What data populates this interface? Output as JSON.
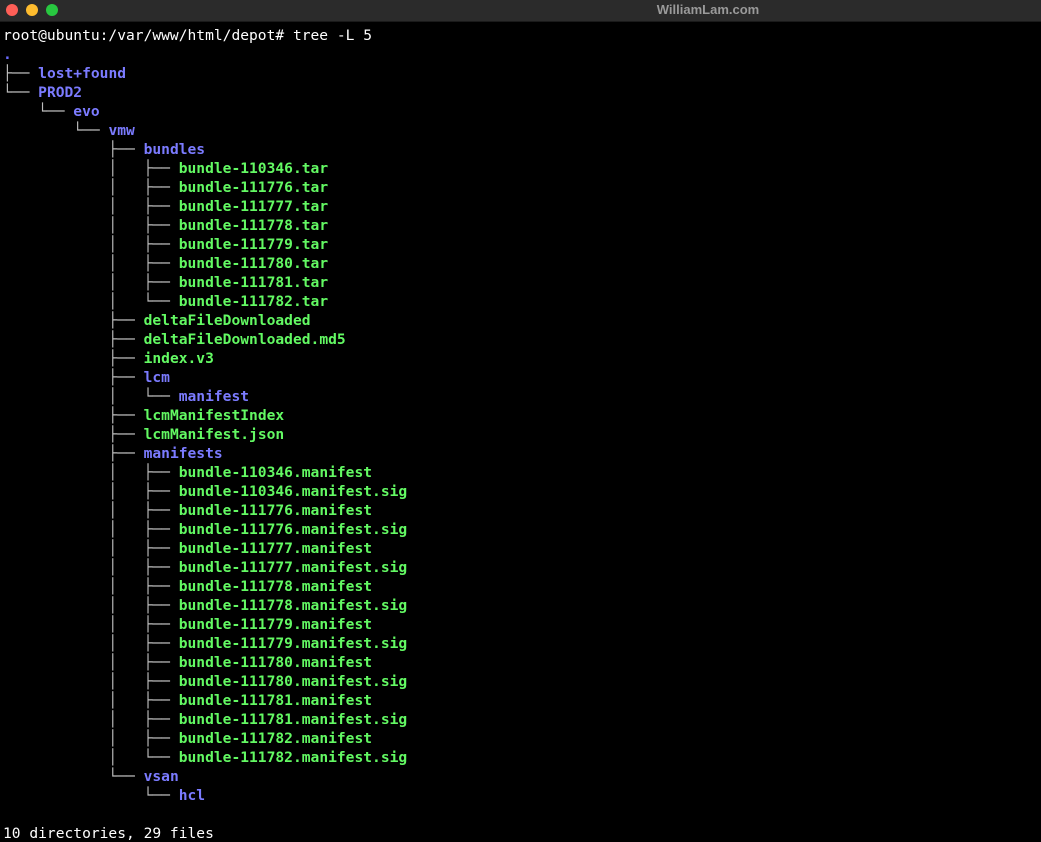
{
  "window": {
    "title": "WilliamLam.com",
    "buttons": {
      "close_color": "#ff5f57",
      "minimize_color": "#febc2e",
      "zoom_color": "#28c840"
    }
  },
  "colors": {
    "directory": "#7b7bff",
    "file": "#63f963",
    "text": "#ffffff",
    "background": "#000000"
  },
  "terminal": {
    "prompt": "root@ubuntu:/var/www/html/depot# tree -L 5",
    "lines": [
      {
        "prefix": "",
        "name": ".",
        "type": "root"
      },
      {
        "prefix": "├── ",
        "name": "lost+found",
        "type": "dir"
      },
      {
        "prefix": "└── ",
        "name": "PROD2",
        "type": "dir"
      },
      {
        "prefix": "    └── ",
        "name": "evo",
        "type": "dir"
      },
      {
        "prefix": "        └── ",
        "name": "vmw",
        "type": "dir"
      },
      {
        "prefix": "            ├── ",
        "name": "bundles",
        "type": "dir"
      },
      {
        "prefix": "            │   ├── ",
        "name": "bundle-110346.tar",
        "type": "file"
      },
      {
        "prefix": "            │   ├── ",
        "name": "bundle-111776.tar",
        "type": "file"
      },
      {
        "prefix": "            │   ├── ",
        "name": "bundle-111777.tar",
        "type": "file"
      },
      {
        "prefix": "            │   ├── ",
        "name": "bundle-111778.tar",
        "type": "file"
      },
      {
        "prefix": "            │   ├── ",
        "name": "bundle-111779.tar",
        "type": "file"
      },
      {
        "prefix": "            │   ├── ",
        "name": "bundle-111780.tar",
        "type": "file"
      },
      {
        "prefix": "            │   ├── ",
        "name": "bundle-111781.tar",
        "type": "file"
      },
      {
        "prefix": "            │   └── ",
        "name": "bundle-111782.tar",
        "type": "file"
      },
      {
        "prefix": "            ├── ",
        "name": "deltaFileDownloaded",
        "type": "file"
      },
      {
        "prefix": "            ├── ",
        "name": "deltaFileDownloaded.md5",
        "type": "file"
      },
      {
        "prefix": "            ├── ",
        "name": "index.v3",
        "type": "file"
      },
      {
        "prefix": "            ├── ",
        "name": "lcm",
        "type": "dir"
      },
      {
        "prefix": "            │   └── ",
        "name": "manifest",
        "type": "dir"
      },
      {
        "prefix": "            ├── ",
        "name": "lcmManifestIndex",
        "type": "file"
      },
      {
        "prefix": "            ├── ",
        "name": "lcmManifest.json",
        "type": "file"
      },
      {
        "prefix": "            ├── ",
        "name": "manifests",
        "type": "dir"
      },
      {
        "prefix": "            │   ├── ",
        "name": "bundle-110346.manifest",
        "type": "file"
      },
      {
        "prefix": "            │   ├── ",
        "name": "bundle-110346.manifest.sig",
        "type": "file"
      },
      {
        "prefix": "            │   ├── ",
        "name": "bundle-111776.manifest",
        "type": "file"
      },
      {
        "prefix": "            │   ├── ",
        "name": "bundle-111776.manifest.sig",
        "type": "file"
      },
      {
        "prefix": "            │   ├── ",
        "name": "bundle-111777.manifest",
        "type": "file"
      },
      {
        "prefix": "            │   ├── ",
        "name": "bundle-111777.manifest.sig",
        "type": "file"
      },
      {
        "prefix": "            │   ├── ",
        "name": "bundle-111778.manifest",
        "type": "file"
      },
      {
        "prefix": "            │   ├── ",
        "name": "bundle-111778.manifest.sig",
        "type": "file"
      },
      {
        "prefix": "            │   ├── ",
        "name": "bundle-111779.manifest",
        "type": "file"
      },
      {
        "prefix": "            │   ├── ",
        "name": "bundle-111779.manifest.sig",
        "type": "file"
      },
      {
        "prefix": "            │   ├── ",
        "name": "bundle-111780.manifest",
        "type": "file"
      },
      {
        "prefix": "            │   ├── ",
        "name": "bundle-111780.manifest.sig",
        "type": "file"
      },
      {
        "prefix": "            │   ├── ",
        "name": "bundle-111781.manifest",
        "type": "file"
      },
      {
        "prefix": "            │   ├── ",
        "name": "bundle-111781.manifest.sig",
        "type": "file"
      },
      {
        "prefix": "            │   ├── ",
        "name": "bundle-111782.manifest",
        "type": "file"
      },
      {
        "prefix": "            │   └── ",
        "name": "bundle-111782.manifest.sig",
        "type": "file"
      },
      {
        "prefix": "            └── ",
        "name": "vsan",
        "type": "dir"
      },
      {
        "prefix": "                └── ",
        "name": "hcl",
        "type": "dir"
      },
      {
        "prefix": "",
        "name": "",
        "type": "blank"
      }
    ],
    "summary": "10 directories, 29 files"
  }
}
